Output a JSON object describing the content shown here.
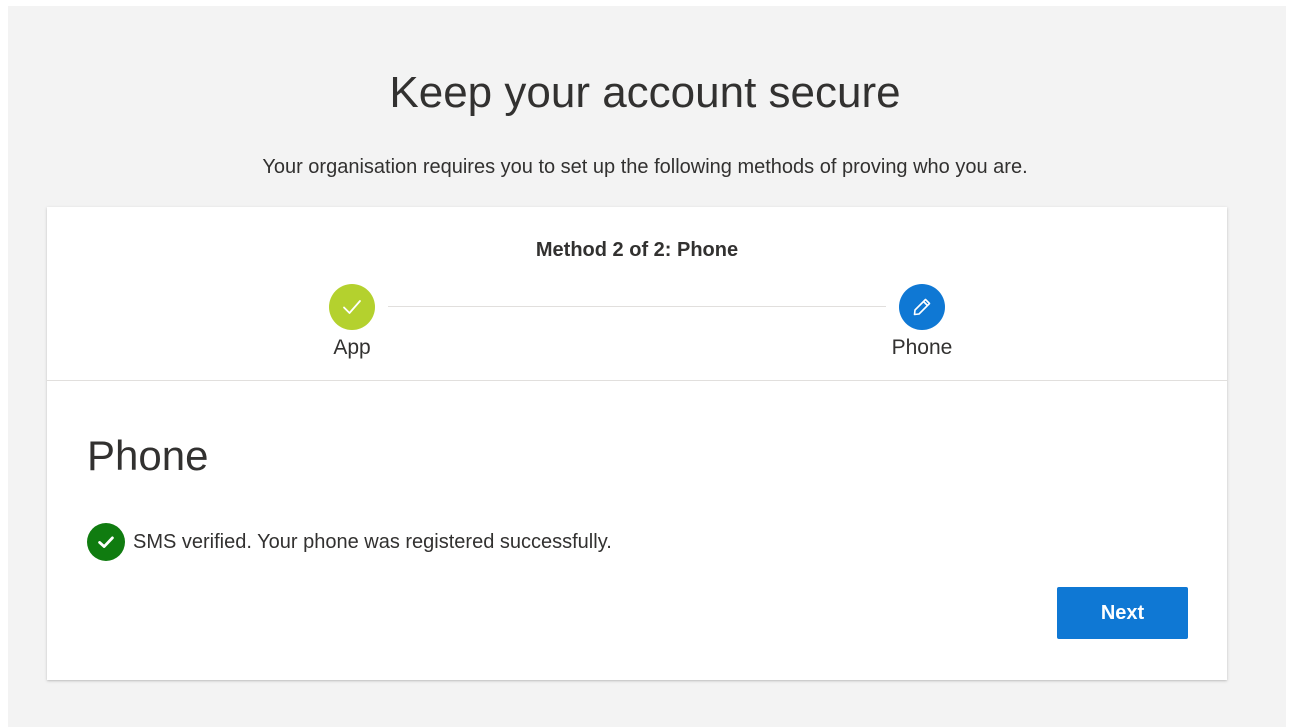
{
  "page": {
    "title": "Keep your account secure",
    "subtitle": "Your organisation requires you to set up the following methods of proving who you are."
  },
  "progress": {
    "method_label": "Method 2 of 2: Phone",
    "steps": [
      {
        "label": "App",
        "state": "completed",
        "icon": "checkmark-icon",
        "color": "#b4d12e"
      },
      {
        "label": "Phone",
        "state": "current",
        "icon": "pencil-icon",
        "color": "#0f78d4"
      }
    ]
  },
  "section": {
    "title": "Phone",
    "status_icon": "success-check-icon",
    "status_color": "#107c10",
    "status_text": "SMS verified. Your phone was registered successfully."
  },
  "actions": {
    "next_label": "Next",
    "primary_color": "#0f78d4"
  }
}
